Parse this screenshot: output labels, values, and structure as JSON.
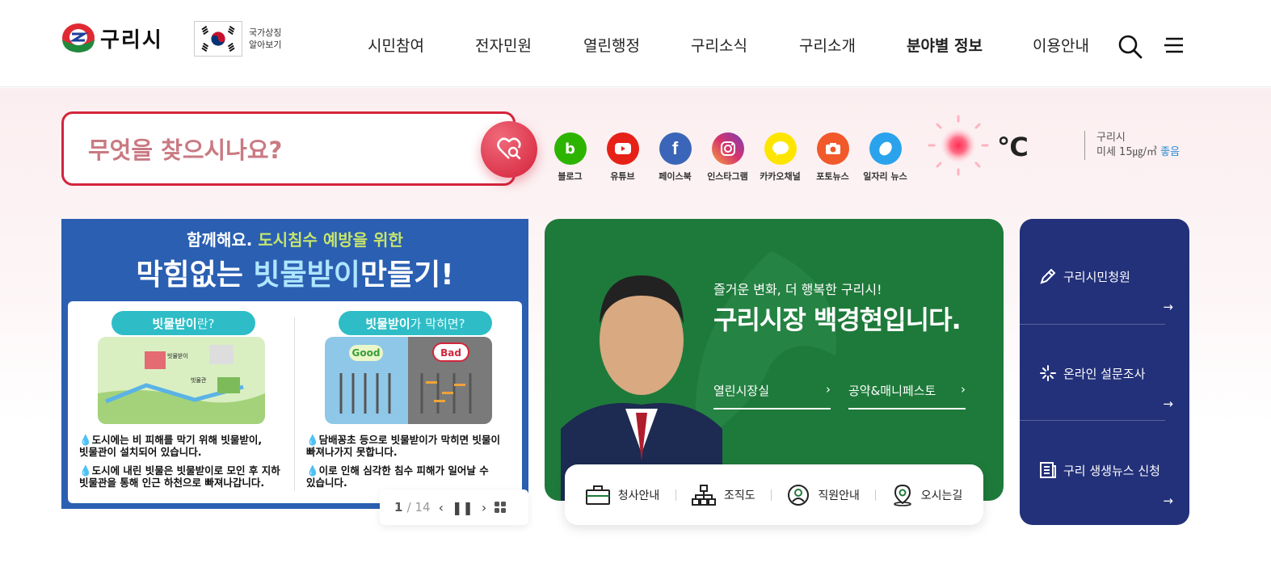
{
  "header": {
    "logo_text": "구리시",
    "symbol_line1": "국가상징",
    "symbol_line2": "알아보기",
    "nav": [
      "시민참여",
      "전자민원",
      "열린행정",
      "구리소식",
      "구리소개",
      "분야별 정보",
      "이용안내"
    ],
    "active_nav": "분야별 정보"
  },
  "search": {
    "placeholder": "무엇을 찾으시나요?"
  },
  "sns": [
    {
      "label": "블로그",
      "icon": "blog-icon",
      "color": "#2db400"
    },
    {
      "label": "유튜브",
      "icon": "youtube-icon",
      "color": "#e62117"
    },
    {
      "label": "페이스북",
      "icon": "facebook-icon",
      "color": "#3b65b8"
    },
    {
      "label": "인스타그램",
      "icon": "instagram-icon",
      "color": "#d6336c"
    },
    {
      "label": "카카오채널",
      "icon": "kakao-channel-icon",
      "color": "#fee500"
    },
    {
      "label": "포토뉴스",
      "icon": "photo-news-icon",
      "color": "#f1592a"
    },
    {
      "label": "일자리 뉴스",
      "icon": "job-news-icon",
      "color": "#2aa3ec"
    }
  ],
  "weather": {
    "temp_unit": "℃",
    "region": "구리시",
    "dust_label": "미세 15㎍/㎥",
    "dust_status": "좋음"
  },
  "banner": {
    "top_line_1": "함께해요.",
    "top_line_hl": "도시침수 예방을 위한",
    "headline_1": "막힘없는",
    "headline_hl": "빗물받이",
    "headline_2": "만들기!",
    "pill_left_b": "빗물받이",
    "pill_left_n": "란?",
    "pill_right_b": "빗물받이",
    "pill_right_n": "가 막히면?",
    "good": "Good",
    "bad": "Bad",
    "left_label_1": "빗물받이",
    "left_label_2": "빗물관",
    "bullet_l1": "도시에는 비 피해를 막기 위해 빗물받이,\n빗물관이 설치되어 있습니다.",
    "bullet_l2": "도시에 내린 빗물은 빗물받이로 모인 후 지하\n빗물관을 통해 인근 하천으로 빠져나갑니다.",
    "bullet_r1": "담배꽁초 등으로 빗물받이가 막히면 빗물이\n빠져나가지 못합니다.",
    "bullet_r2": "이로 인해 심각한 침수 피해가 일어날 수\n있습니다.",
    "page_current": "1",
    "page_total": "/ 14"
  },
  "mayor": {
    "subtitle": "즐거운 변화, 더 행복한 구리시!",
    "title": "구리시장 백경현입니다.",
    "link1": "열린시장실",
    "link2": "공약&매니페스토"
  },
  "quick": [
    {
      "label": "청사안내",
      "icon": "briefcase-icon"
    },
    {
      "label": "조직도",
      "icon": "org-chart-icon"
    },
    {
      "label": "직원안내",
      "icon": "user-icon"
    },
    {
      "label": "오시는길",
      "icon": "map-pin-icon"
    }
  ],
  "side": [
    {
      "label": "구리시민청원",
      "icon": "pen-icon"
    },
    {
      "label": "온라인 설문조사",
      "icon": "sparkle-icon"
    },
    {
      "label": "구리 생생뉴스 신청",
      "icon": "newspaper-icon"
    }
  ],
  "colors": {
    "brand_red": "#d3253b",
    "mayor_green": "#1e7a3a",
    "side_navy": "#23317a",
    "banner_blue": "#2a5fb2"
  }
}
